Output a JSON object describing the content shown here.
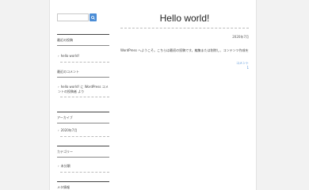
{
  "search": {
    "placeholder": "",
    "button_icon": "search-icon",
    "button_color": "#4b8dd6"
  },
  "sidebar": {
    "widgets": [
      {
        "title": "最近の投稿",
        "items": [
          {
            "chev": "›",
            "label": "hello world!"
          }
        ]
      },
      {
        "title": "最近のコメント",
        "items": [
          {
            "chev": "›",
            "label": "hello world! に WordPress コメントの投稿者 より"
          }
        ]
      },
      {
        "title": "アーカイブ",
        "items": [
          {
            "chev": "›",
            "label": "2020年7月"
          }
        ]
      },
      {
        "title": "カテゴリー",
        "items": [
          {
            "chev": "›",
            "label": "未分類"
          }
        ]
      },
      {
        "title": "メタ情報",
        "items": []
      }
    ]
  },
  "post": {
    "title": "Hello world!",
    "date": "2020年7月",
    "body": "WordPress へようこそ。こちらは最初の投稿です。編集または削除し、コンテンツ作成を始めてください。",
    "meta": "コメント 1"
  }
}
